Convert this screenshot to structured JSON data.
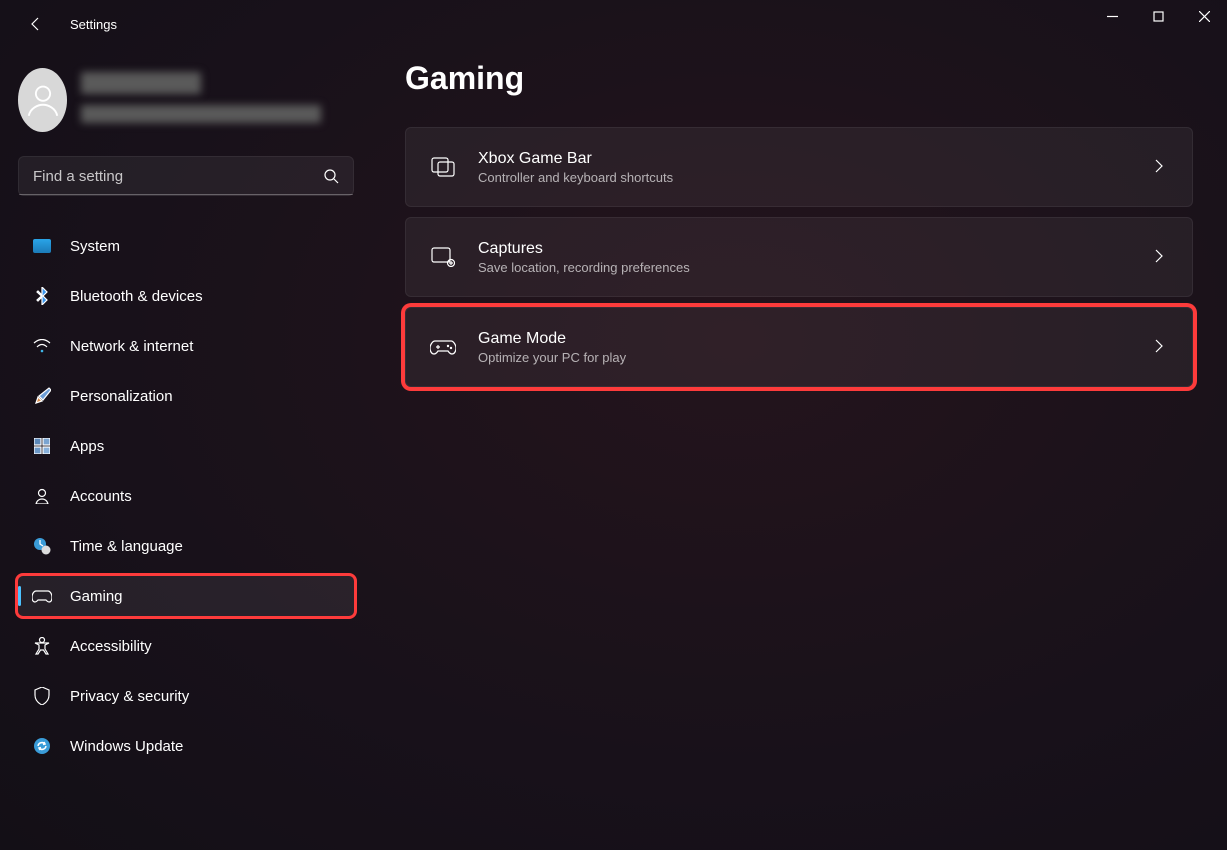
{
  "app_title": "Settings",
  "search": {
    "placeholder": "Find a setting"
  },
  "sidebar": {
    "items": [
      {
        "label": "System",
        "icon": "🖥️"
      },
      {
        "label": "Bluetooth & devices",
        "icon": "bluetooth"
      },
      {
        "label": "Network & internet",
        "icon": "📶"
      },
      {
        "label": "Personalization",
        "icon": "🖌️"
      },
      {
        "label": "Apps",
        "icon": "▦"
      },
      {
        "label": "Accounts",
        "icon": "👤"
      },
      {
        "label": "Time & language",
        "icon": "🕑"
      },
      {
        "label": "Gaming",
        "icon": "🎮",
        "active": true,
        "highlight": true
      },
      {
        "label": "Accessibility",
        "icon": "accessibility"
      },
      {
        "label": "Privacy & security",
        "icon": "🛡️"
      },
      {
        "label": "Windows Update",
        "icon": "🔄"
      }
    ]
  },
  "page": {
    "title": "Gaming",
    "cards": [
      {
        "title": "Xbox Game Bar",
        "subtitle": "Controller and keyboard shortcuts"
      },
      {
        "title": "Captures",
        "subtitle": "Save location, recording preferences"
      },
      {
        "title": "Game Mode",
        "subtitle": "Optimize your PC for play",
        "highlight": true
      }
    ]
  }
}
